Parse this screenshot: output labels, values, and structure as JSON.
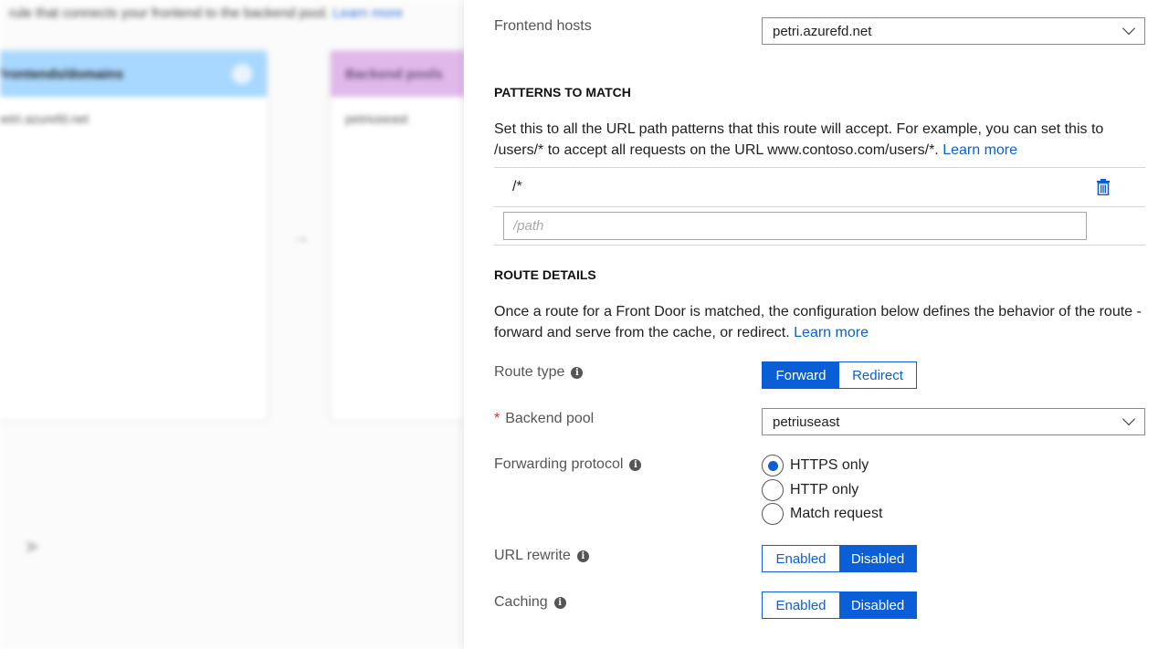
{
  "background": {
    "intro_text": "rule that connects your frontend to the backend pool.",
    "intro_link": "Learn more",
    "frontend_card": {
      "title": "Frontends/domains",
      "item": "petri.azurefd.net"
    },
    "backend_card": {
      "title": "Backend pools",
      "item": "petriuseast"
    }
  },
  "panel": {
    "frontend_hosts": {
      "label": "Frontend hosts",
      "value": "petri.azurefd.net"
    },
    "patterns": {
      "title": "PATTERNS TO MATCH",
      "description": "Set this to all the URL path patterns that this route will accept. For example, you can set this to /users/* to accept all requests on the URL www.contoso.com/users/*.",
      "learn_more": "Learn more",
      "items": [
        "/*"
      ],
      "new_placeholder": "/path"
    },
    "route_details": {
      "title": "ROUTE DETAILS",
      "description": "Once a route for a Front Door is matched, the configuration below defines the behavior of the route - forward and serve from the cache, or redirect.",
      "learn_more": "Learn more"
    },
    "route_type": {
      "label": "Route type",
      "options": [
        "Forward",
        "Redirect"
      ],
      "selected": "Forward"
    },
    "backend_pool": {
      "label": "Backend pool",
      "required_mark": "*",
      "value": "petriuseast"
    },
    "forwarding_protocol": {
      "label": "Forwarding protocol",
      "options": [
        "HTTPS only",
        "HTTP only",
        "Match request"
      ],
      "selected": "HTTPS only"
    },
    "url_rewrite": {
      "label": "URL rewrite",
      "options": [
        "Enabled",
        "Disabled"
      ],
      "selected": "Disabled"
    },
    "caching": {
      "label": "Caching",
      "options": [
        "Enabled",
        "Disabled"
      ],
      "selected": "Disabled"
    }
  },
  "colors": {
    "accent": "#0b5fd6",
    "required": "#d92c2c",
    "frontend_header": "#a8d8ff",
    "backend_header": "#e0b8ea"
  }
}
